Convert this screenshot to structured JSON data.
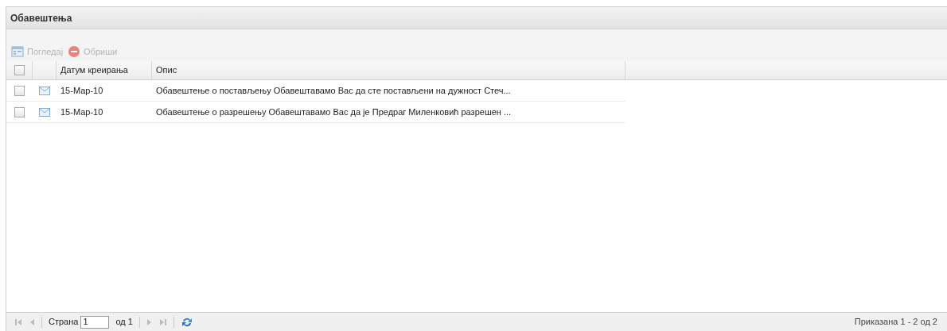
{
  "panel": {
    "title": "Обавештења"
  },
  "toolbar": [
    {
      "kind": "view",
      "label": "Погледај",
      "disabled": true
    },
    {
      "kind": "delete",
      "label": "Обриши",
      "disabled": true
    }
  ],
  "table": {
    "select_all": {
      "checked": false
    },
    "columns": [
      "Датум креирања",
      "Опис"
    ],
    "rows": [
      {
        "checked": false,
        "date": "15-Мар-10",
        "description": "Обавештење о постављењу Обавештавамо Вас да сте постављени на дужност Стеч..."
      },
      {
        "checked": false,
        "date": "15-Мар-10",
        "description": "Обавештење о разрешењу Обавештавамо Вас да је Предраг Миленковић разрешен ..."
      }
    ]
  },
  "pager": {
    "page_label": "Страна",
    "page": "1",
    "of_label": "од 1",
    "summary": "Приказана 1 - 2 од 2"
  }
}
